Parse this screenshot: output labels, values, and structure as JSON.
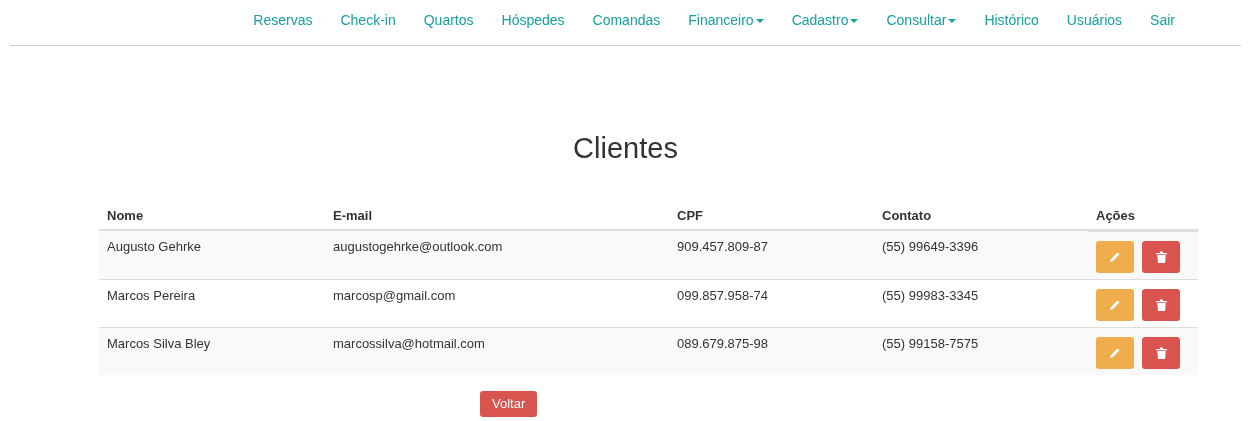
{
  "nav": [
    {
      "label": "Reservas",
      "kind": "link"
    },
    {
      "label": "Check-in",
      "kind": "link"
    },
    {
      "label": "Quartos",
      "kind": "link"
    },
    {
      "label": "Hóspedes",
      "kind": "link"
    },
    {
      "label": "Comandas",
      "kind": "link"
    },
    {
      "label": "Financeiro",
      "kind": "dropdown"
    },
    {
      "label": "Cadastro",
      "kind": "dropdown"
    },
    {
      "label": "Consultar",
      "kind": "dropdown"
    },
    {
      "label": "Histórico",
      "kind": "link"
    },
    {
      "label": "Usuários",
      "kind": "link"
    },
    {
      "label": "Sair",
      "kind": "link"
    }
  ],
  "title": "Clientes",
  "table": {
    "columns": [
      "Nome",
      "E-mail",
      "CPF",
      "Contato",
      "Ações"
    ],
    "rows": [
      {
        "cells": [
          "Augusto Gehrke",
          "augustogehrke@outlook.com",
          "909.457.809-87",
          "(55) 99649-3396"
        ]
      },
      {
        "cells": [
          "Marcos Pereira",
          "marcosp@gmail.com",
          "099.857.958-74",
          "(55) 99983-3345"
        ]
      },
      {
        "cells": [
          "Marcos Silva Bley",
          "marcossilva@hotmail.com",
          "089.679.875-98",
          "(55) 99158-7575"
        ]
      }
    ]
  },
  "back_button": "Voltar"
}
